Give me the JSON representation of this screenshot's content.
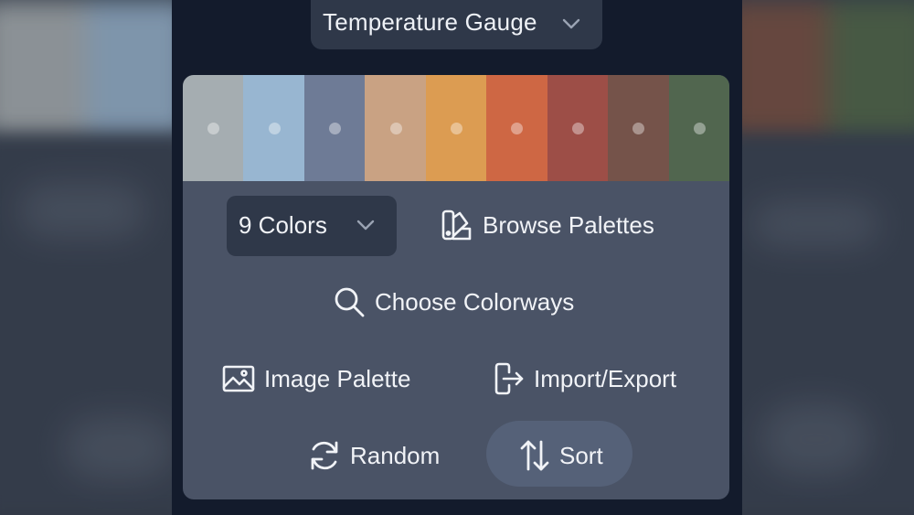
{
  "title_dropdown": {
    "label": "Temperature Gauge"
  },
  "swatches": [
    {
      "color": "#a5adb1"
    },
    {
      "color": "#98b6d1"
    },
    {
      "color": "#6e7b96"
    },
    {
      "color": "#c9a283"
    },
    {
      "color": "#dc9c52"
    },
    {
      "color": "#ce6744"
    },
    {
      "color": "#9d4e47"
    },
    {
      "color": "#75534a"
    },
    {
      "color": "#51664f"
    }
  ],
  "controls": {
    "colors_count": "9 Colors",
    "browse_palettes": "Browse Palettes",
    "choose_colorways": "Choose Colorways",
    "image_palette": "Image Palette",
    "import_export": "Import/Export",
    "random": "Random",
    "sort": "Sort"
  },
  "theme": {
    "app_bg": "#131b2c",
    "panel_bg": "#4a5366",
    "dropdown_bg": "#2f3849",
    "text": "#f1f3f7"
  }
}
